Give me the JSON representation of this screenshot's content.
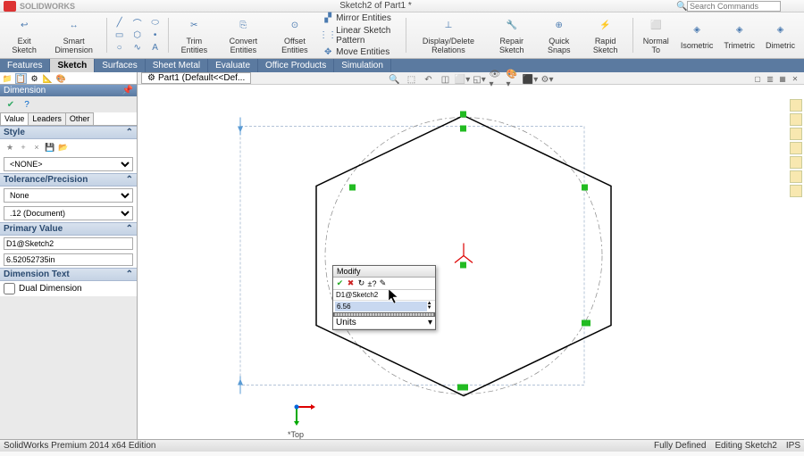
{
  "app": {
    "name": "SOLIDWORKS",
    "document_title": "Sketch2 of Part1 *"
  },
  "search": {
    "placeholder": "Search Commands"
  },
  "ribbon": {
    "exit_sketch": "Exit\nSketch",
    "smart_dim": "Smart\nDimension",
    "trim": "Trim\nEntities",
    "convert": "Convert\nEntities",
    "offset": "Offset\nEntities",
    "mirror": "Mirror Entities",
    "linear_pattern": "Linear Sketch Pattern",
    "move": "Move Entities",
    "display_delete": "Display/Delete\nRelations",
    "repair": "Repair\nSketch",
    "quick_snaps": "Quick\nSnaps",
    "rapid": "Rapid\nSketch",
    "normal_to": "Normal\nTo",
    "isometric": "Isometric",
    "trimetric": "Trimetric",
    "dimetric": "Dimetric"
  },
  "cmd_tabs": [
    "Features",
    "Sketch",
    "Surfaces",
    "Sheet Metal",
    "Evaluate",
    "Office Products",
    "Simulation"
  ],
  "cmd_active": "Sketch",
  "feature_tree_tab": "Part1 (Default<<Def...",
  "prop": {
    "title": "Dimension",
    "tabs": [
      "Value",
      "Leaders",
      "Other"
    ],
    "active_tab": "Value",
    "style": {
      "header": "Style",
      "value": "<NONE>"
    },
    "tolerance": {
      "header": "Tolerance/Precision",
      "type": "None",
      "precision": ".12 (Document)"
    },
    "primary": {
      "header": "Primary Value",
      "name": "D1@Sketch2",
      "value": "6.52052735in"
    },
    "dim_text": {
      "header": "Dimension Text"
    },
    "dual_dim": "Dual Dimension"
  },
  "modify": {
    "title": "Modify",
    "name": "D1@Sketch2",
    "value": "6.56",
    "units_label": "Units"
  },
  "triad_label": "*Top",
  "status_bar": {
    "left": "SolidWorks Premium 2014 x64 Edition",
    "state": "Fully Defined",
    "editing": "Editing Sketch2",
    "units": "IPS"
  }
}
